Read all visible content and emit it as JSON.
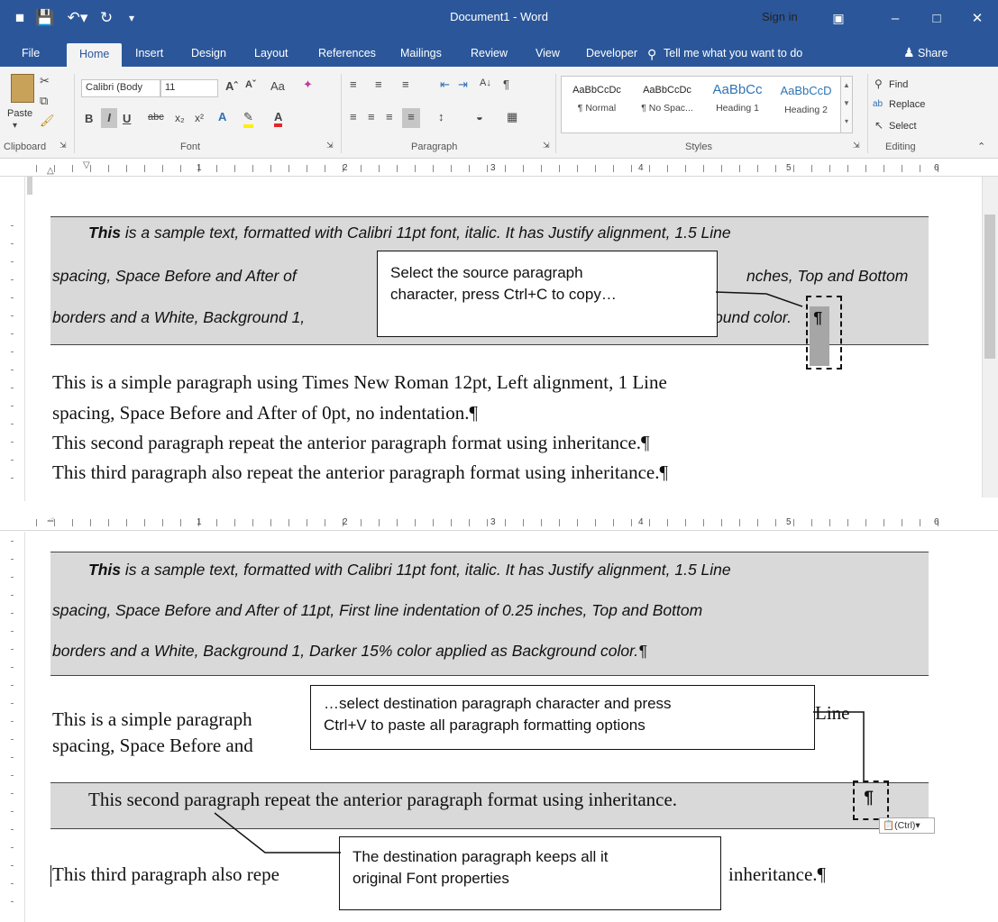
{
  "titlebar": {
    "title": "Document1 - Word",
    "signin": "Sign in",
    "icons": [
      "save-icon",
      "undo-icon",
      "redo-icon",
      "customize-icon"
    ]
  },
  "tabs": {
    "file": "File",
    "home": "Home",
    "insert": "Insert",
    "design": "Design",
    "layout": "Layout",
    "references": "References",
    "mailings": "Mailings",
    "review": "Review",
    "view": "View",
    "developer": "Developer"
  },
  "tellme": "Tell me what you want to do",
  "share": "Share",
  "ribbon": {
    "clipboard": {
      "label": "Clipboard",
      "paste": "Paste"
    },
    "font": {
      "label": "Font",
      "name": "Calibri (Body",
      "size": "11",
      "change_case": "Aa"
    },
    "paragraph": {
      "label": "Paragraph"
    },
    "styles": {
      "label": "Styles",
      "items": [
        {
          "sample": "AaBbCcDc",
          "name": "¶ Normal"
        },
        {
          "sample": "AaBbCcDc",
          "name": "¶ No Spac..."
        },
        {
          "sample": "AaBbCc",
          "name": "Heading 1"
        },
        {
          "sample": "AaBbCcD",
          "name": "Heading 2"
        }
      ]
    },
    "editing": {
      "label": "Editing",
      "find": "Find",
      "replace": "Replace",
      "select": "Select"
    }
  },
  "ruler": {
    "numbers": [
      "1",
      "2",
      "3",
      "4",
      "5",
      "6"
    ]
  },
  "top_doc": {
    "shaded_lines": [
      {
        "bold": "This",
        "rest": " is a sample text, formatted with Calibri 11pt font, italic. It has Justify alignment, 1.5 Line"
      },
      {
        "bold": "",
        "rest": "spacing, Space Before and After of"
      },
      {
        "bold": "",
        "rest": "borders and a White, Background 1,"
      }
    ],
    "shaded_tails": [
      "nches, Top and Bottom",
      "ound color."
    ],
    "pilcrow": "¶",
    "times_lines": [
      "This is a simple paragraph using Times New Roman 12pt, Left alignment, 1 Line",
      "spacing, Space Before and After of 0pt, no indentation.¶",
      "This second paragraph repeat the anterior paragraph format using inheritance.¶",
      "This third paragraph also repeat the anterior paragraph format using inheritance.¶"
    ],
    "callout": [
      "Select the source paragraph",
      "character, press Ctrl+C to copy…"
    ]
  },
  "bottom_doc": {
    "shaded_lines": [
      {
        "bold": "This",
        "rest": " is a sample text, formatted with Calibri 11pt font, italic. It has Justify alignment, 1.5 Line"
      },
      {
        "bold": "",
        "rest": "spacing, Space Before and After of 11pt, First line indentation of 0.25 inches, Top and Bottom"
      },
      {
        "bold": "",
        "rest": "borders and a White, Background 1, Darker 15% color applied as Background color.¶"
      }
    ],
    "times_line1_left": "This is a simple paragraph",
    "times_line1_right": "Line",
    "times_line2_left": "spacing, Space Before and",
    "second_para": "This second paragraph repeat the anterior paragraph format using inheritance.",
    "pilcrow": "¶",
    "third_left": "This third paragraph also repe",
    "third_right": "inheritance.¶",
    "callout_paste": [
      "…select destination paragraph character and press",
      "Ctrl+V to paste all paragraph formatting options"
    ],
    "callout_keep": [
      "The destination paragraph keeps all it",
      "original Font properties"
    ],
    "paste_options": "(Ctrl)"
  }
}
